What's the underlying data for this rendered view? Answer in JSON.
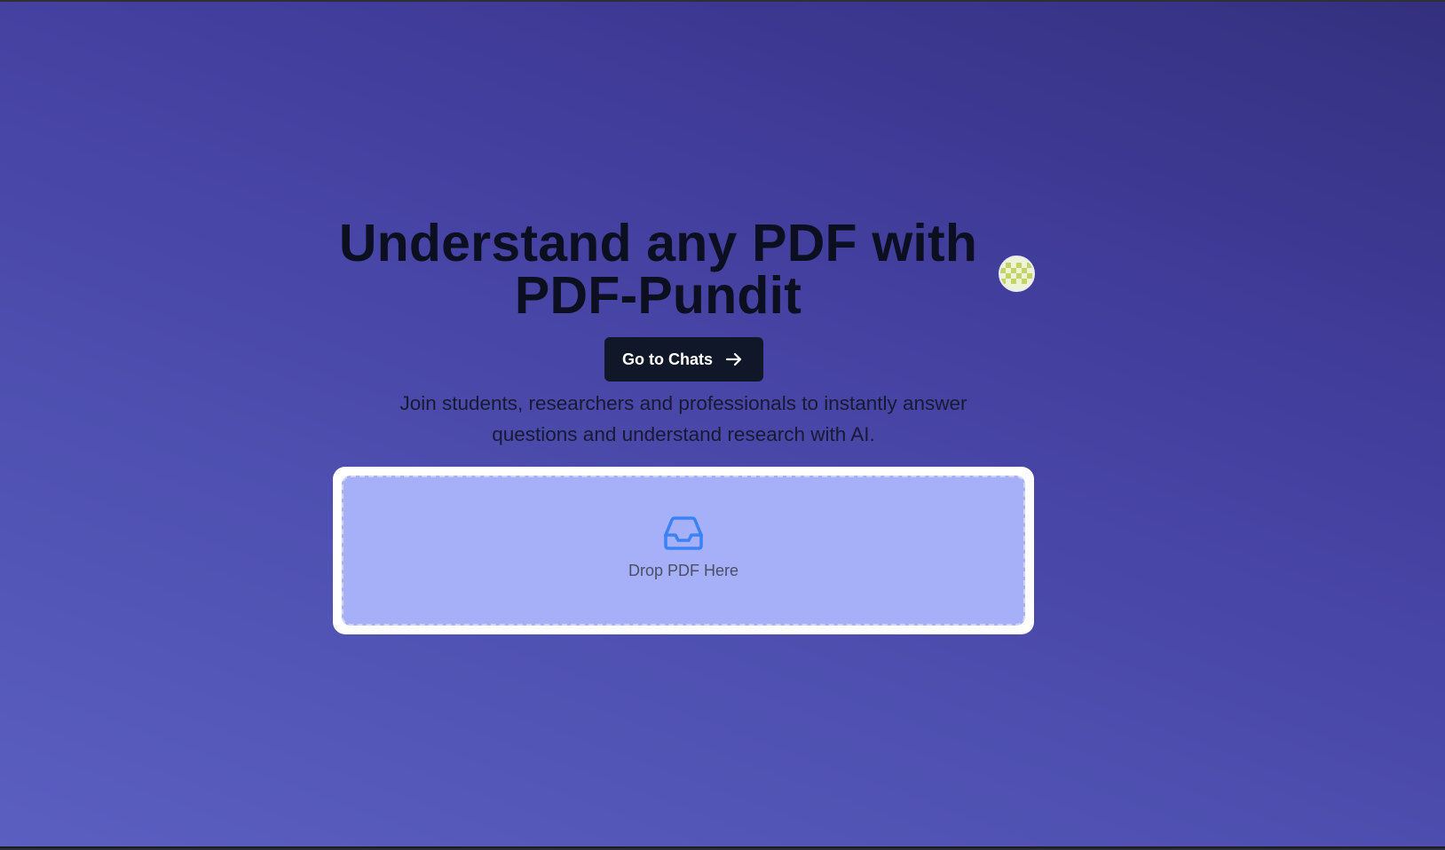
{
  "hero": {
    "title_line1": "Understand any PDF with",
    "title_line2": "PDF-Pundit",
    "cta_label": "Go to Chats",
    "subtitle_line1": "Join students, researchers and professionals to instantly answer",
    "subtitle_line2": "questions and understand research with AI."
  },
  "upload": {
    "label": "Drop PDF Here",
    "icon": "inbox-icon"
  },
  "user": {
    "avatar_icon": "user-avatar"
  },
  "colors": {
    "background_start": "#34307f",
    "background_end": "#5b5fc0",
    "button": "#0f1729",
    "dropzone": "#a5b0f9",
    "icon_accent": "#3b82f6"
  }
}
